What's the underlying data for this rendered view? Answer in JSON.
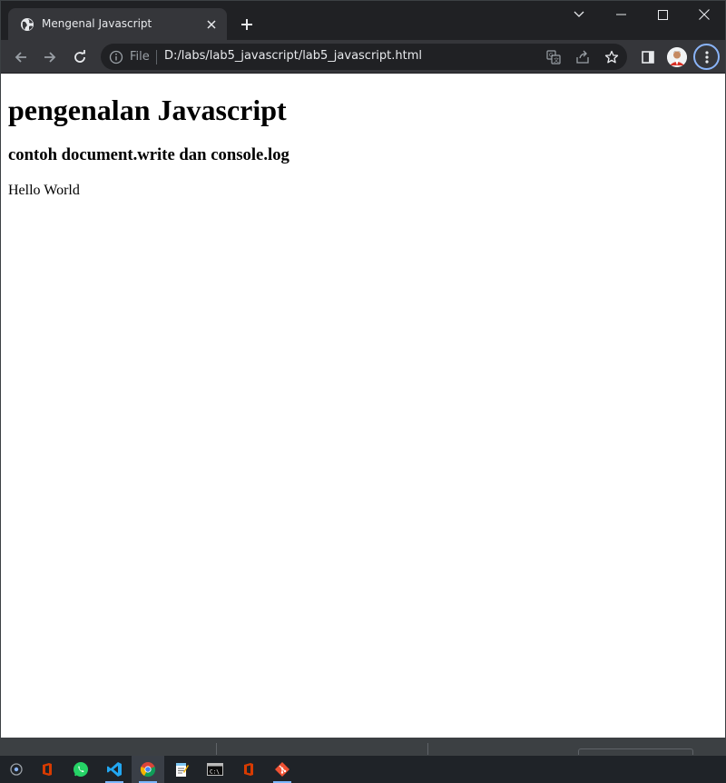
{
  "browser": {
    "tab": {
      "title": "Mengenal Javascript",
      "favicon": "globe-icon"
    },
    "address_bar": {
      "scheme_label": "File",
      "url": "D:/labs/lab5_javascript/lab5_javascript.html"
    },
    "colors": {
      "frame": "#202124",
      "toolbar": "#35363a",
      "focus_ring": "#8ab4f8"
    }
  },
  "page": {
    "heading1": "pengenalan Javascript",
    "heading3": "contoh document.write dan console.log",
    "paragraph": "Hello World"
  },
  "taskbar": {
    "apps": [
      "start-circle-icon",
      "office-icon",
      "whatsapp-icon",
      "vscode-icon",
      "chrome-icon",
      "notepad-icon",
      "terminal-icon",
      "office-icon",
      "git-icon"
    ],
    "active_app": "chrome-icon"
  }
}
